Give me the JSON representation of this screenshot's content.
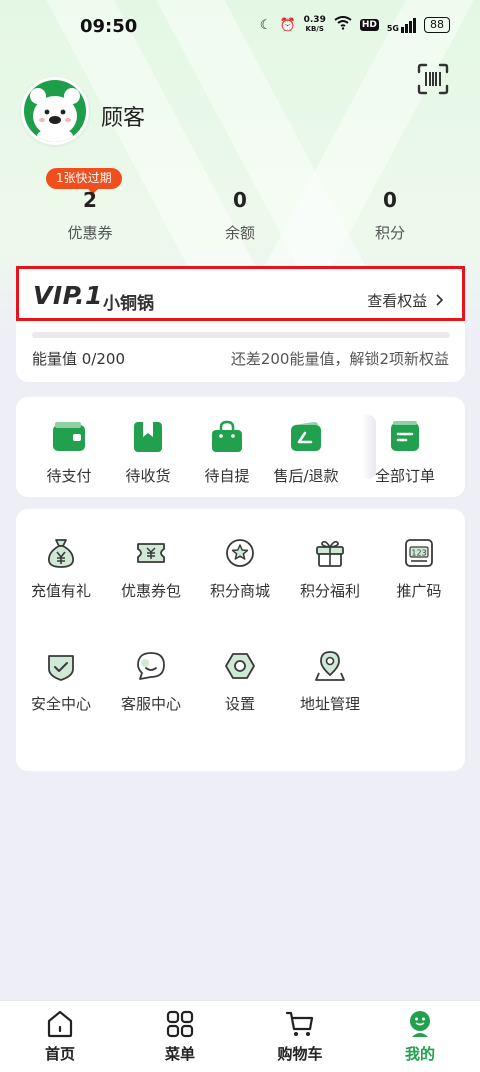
{
  "status_bar": {
    "time": "09:50",
    "net_speed_value": "0.39",
    "net_speed_unit": "KB/S",
    "hd": "HD",
    "signal": "5G",
    "battery": "88"
  },
  "profile": {
    "name": "顾客"
  },
  "stats": {
    "expire_badge": "1张快过期",
    "items": [
      {
        "value": "2",
        "label": "优惠券"
      },
      {
        "value": "0",
        "label": "余额"
      },
      {
        "value": "0",
        "label": "积分"
      }
    ]
  },
  "vip": {
    "level": "VIP.1",
    "level_name": "小铜锅",
    "link": "查看权益",
    "progress": 0,
    "energy": "能量值 0/200",
    "tip": "还差200能量值，解锁2项新权益"
  },
  "orders": [
    {
      "label": "待支付",
      "icon": "wallet-icon"
    },
    {
      "label": "待收货",
      "icon": "receive-icon"
    },
    {
      "label": "待自提",
      "icon": "bag-icon"
    },
    {
      "label": "售后/退款",
      "icon": "refund-icon"
    },
    {
      "label": "全部订单",
      "icon": "order-list-icon"
    }
  ],
  "services": [
    {
      "label": "充值有礼",
      "icon": "money-bag-icon"
    },
    {
      "label": "优惠券包",
      "icon": "coupon-icon"
    },
    {
      "label": "积分商城",
      "icon": "star-badge-icon"
    },
    {
      "label": "积分福利",
      "icon": "gift-icon"
    },
    {
      "label": "推广码",
      "icon": "code-icon"
    },
    {
      "label": "安全中心",
      "icon": "shield-icon"
    },
    {
      "label": "客服中心",
      "icon": "chat-icon"
    },
    {
      "label": "设置",
      "icon": "settings-icon"
    },
    {
      "label": "地址管理",
      "icon": "location-icon"
    }
  ],
  "tabbar": [
    {
      "label": "首页",
      "icon": "home-icon"
    },
    {
      "label": "菜单",
      "icon": "menu-grid-icon"
    },
    {
      "label": "购物车",
      "icon": "cart-icon"
    },
    {
      "label": "我的",
      "icon": "profile-icon",
      "active": true
    }
  ],
  "colors": {
    "brand_green": "#21a14d",
    "badge_orange": "#f04e1d",
    "highlight_red": "#e8141b"
  }
}
